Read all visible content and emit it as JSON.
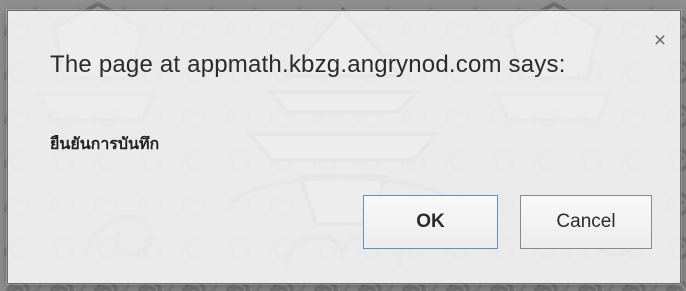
{
  "dialog": {
    "title": "The page at appmath.kbzg.angrynod.com says:",
    "message": "ยืนยันการบันทึก",
    "close_symbol": "×",
    "buttons": {
      "ok_label": "OK",
      "cancel_label": "Cancel"
    }
  },
  "colors": {
    "dialog_background": "#f8f8f8",
    "ok_border": "#5b8fd6",
    "text": "#2b2b2b"
  },
  "icons": {
    "close": "close-icon"
  }
}
